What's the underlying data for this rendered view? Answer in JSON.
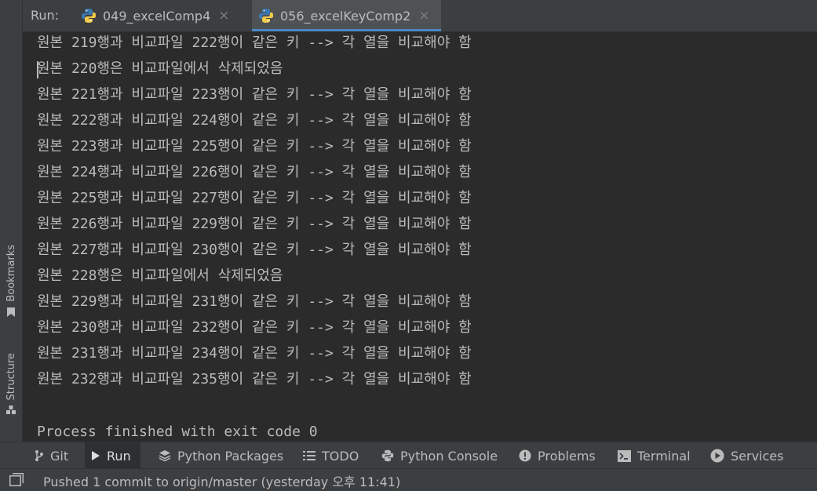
{
  "run_panel": {
    "label": "Run:",
    "tabs": [
      {
        "title": "049_excelComp4",
        "icon": "python-icon",
        "active": false
      },
      {
        "title": "056_excelKeyComp2",
        "icon": "python-icon",
        "active": true
      }
    ],
    "close_glyph": "×"
  },
  "console": {
    "lines": [
      "원본 219행과 비교파일 222행이 같은 키 --> 각 열을 비교해야 함",
      "원본 220행은 비교파일에서 삭제되었음",
      "원본 221행과 비교파일 223행이 같은 키 --> 각 열을 비교해야 함",
      "원본 222행과 비교파일 224행이 같은 키 --> 각 열을 비교해야 함",
      "원본 223행과 비교파일 225행이 같은 키 --> 각 열을 비교해야 함",
      "원본 224행과 비교파일 226행이 같은 키 --> 각 열을 비교해야 함",
      "원본 225행과 비교파일 227행이 같은 키 --> 각 열을 비교해야 함",
      "원본 226행과 비교파일 229행이 같은 키 --> 각 열을 비교해야 함",
      "원본 227행과 비교파일 230행이 같은 키 --> 각 열을 비교해야 함",
      "원본 228행은 비교파일에서 삭제되었음",
      "원본 229행과 비교파일 231행이 같은 키 --> 각 열을 비교해야 함",
      "원본 230행과 비교파일 232행이 같은 키 --> 각 열을 비교해야 함",
      "원본 231행과 비교파일 234행이 같은 키 --> 각 열을 비교해야 함",
      "원본 232행과 비교파일 235행이 같은 키 --> 각 열을 비교해야 함",
      "",
      "Process finished with exit code 0"
    ]
  },
  "side_tools": {
    "bookmarks": {
      "label": "Bookmarks",
      "icon": "bookmark-icon"
    },
    "structure": {
      "label": "Structure",
      "icon": "structure-icon"
    }
  },
  "bottom_tools": {
    "git": {
      "label": "Git",
      "icon": "git-branch-icon"
    },
    "run": {
      "label": "Run",
      "icon": "play-icon"
    },
    "python_packages": {
      "label": "Python Packages",
      "icon": "layers-icon"
    },
    "todo": {
      "label": "TODO",
      "icon": "list-icon"
    },
    "python_console": {
      "label": "Python Console",
      "icon": "python-icon"
    },
    "problems": {
      "label": "Problems",
      "icon": "alert-icon"
    },
    "terminal": {
      "label": "Terminal",
      "icon": "terminal-icon"
    },
    "services": {
      "label": "Services",
      "icon": "services-icon"
    }
  },
  "status_bar": {
    "message": "Pushed 1 commit to origin/master (yesterday 오후 11:41)",
    "icon": "layout-icon"
  },
  "colors": {
    "editor_bg": "#2b2b2b",
    "panel_bg": "#3c3f41",
    "text": "#bbbbbb",
    "accent": "#4a88c7",
    "python_blue": "#3b77b0",
    "python_yellow": "#f2c94c"
  }
}
